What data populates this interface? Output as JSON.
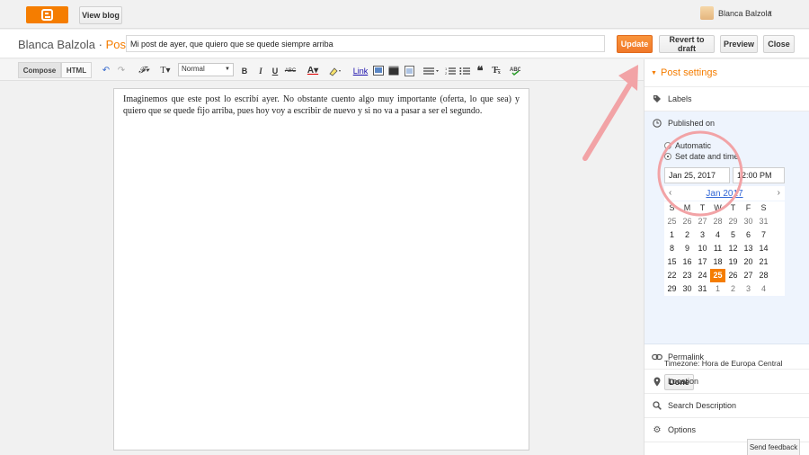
{
  "topbar": {
    "view_blog": "View blog",
    "user_name": "Blanca Balzola",
    "caret": "▾"
  },
  "title_row": {
    "blog_name": "Blanca Balzola",
    "separator": " · ",
    "section": "Post",
    "post_title": "Mi post de ayer, que quiero que se quede siempre arriba",
    "update": "Update",
    "revert": "Revert to draft",
    "preview": "Preview",
    "close": "Close"
  },
  "toolbar": {
    "compose": "Compose",
    "html": "HTML",
    "font": "Normal",
    "bold": "B",
    "italic": "I",
    "underline": "U",
    "strike": "ABC",
    "link": "Link"
  },
  "editor": {
    "body": "Imaginemos que este post lo escribí ayer. No obstante cuento algo muy importante (oferta, lo que sea) y quiero que se quede fijo arriba, pues hoy voy a escribir de nuevo y si no va a pasar a ser el segundo."
  },
  "sidebar": {
    "header": "Post settings",
    "labels": "Labels",
    "published_on": "Published on",
    "automatic": "Automatic",
    "set_date": "Set date and time",
    "date": "Jan 25, 2017",
    "time": "12:00 PM",
    "timezone": "Timezone: Hora de Europa Central",
    "done": "Done",
    "permalink": "Permalink",
    "location": "Location",
    "search_description": "Search Description",
    "options": "Options"
  },
  "calendar": {
    "month": "Jan 2017",
    "prev": "‹",
    "next": "›",
    "weekdays": [
      "S",
      "M",
      "T",
      "W",
      "T",
      "F",
      "S"
    ],
    "weeks": [
      [
        "25",
        "26",
        "27",
        "28",
        "29",
        "30",
        "31"
      ],
      [
        "1",
        "2",
        "3",
        "4",
        "5",
        "6",
        "7"
      ],
      [
        "8",
        "9",
        "10",
        "11",
        "12",
        "13",
        "14"
      ],
      [
        "15",
        "16",
        "17",
        "18",
        "19",
        "20",
        "21"
      ],
      [
        "22",
        "23",
        "24",
        "25",
        "26",
        "27",
        "28"
      ],
      [
        "29",
        "30",
        "31",
        "1",
        "2",
        "3",
        "4"
      ]
    ],
    "selected": "25"
  },
  "feedback": "Send feedback",
  "colors": {
    "accent": "#f57d00",
    "annotation": "#f2a3a6",
    "link": "#3367d6"
  }
}
